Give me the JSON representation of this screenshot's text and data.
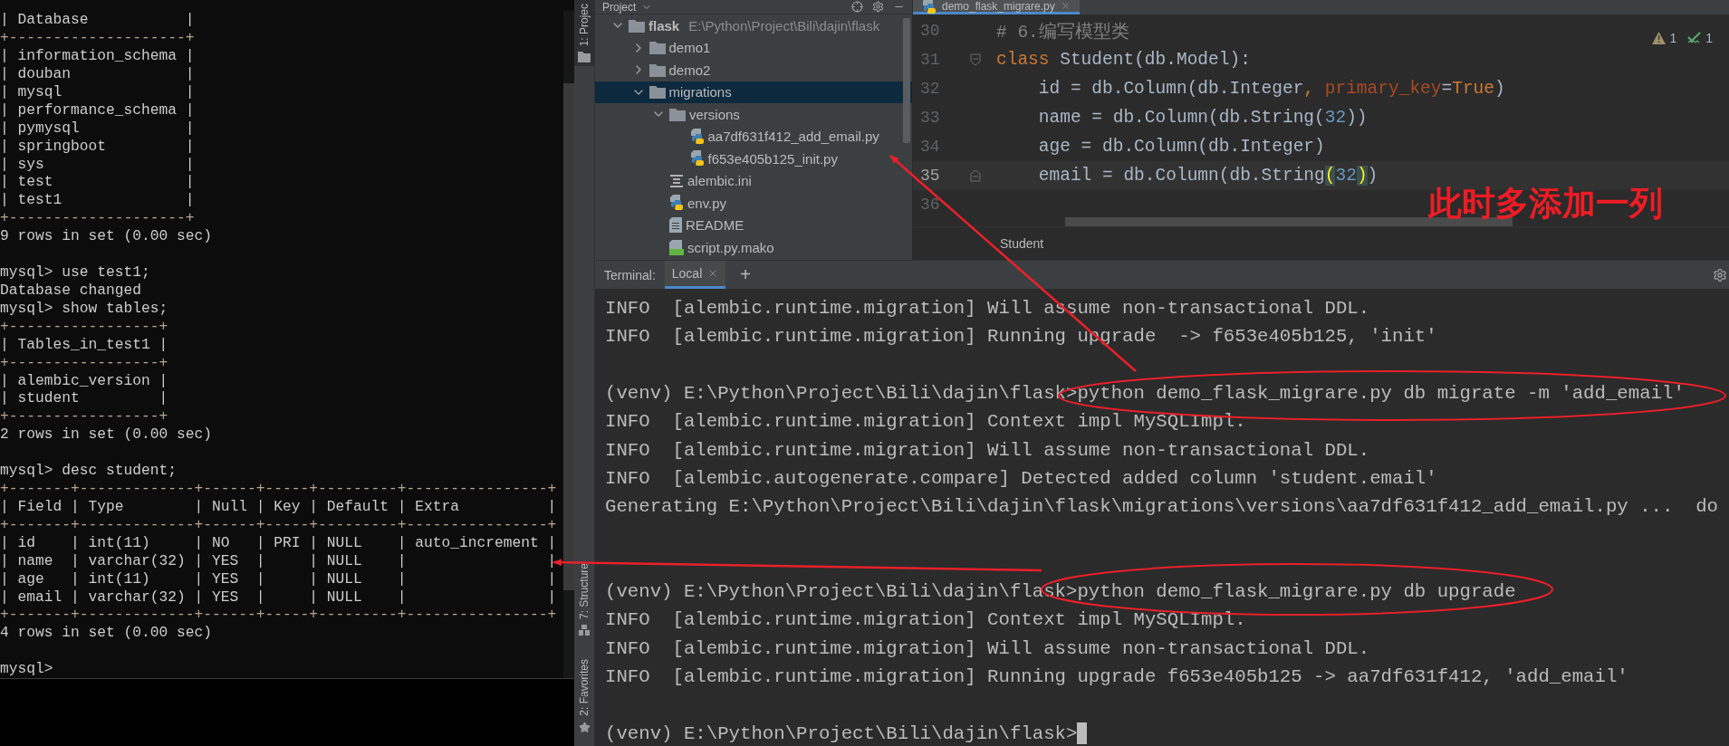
{
  "mysql_console": {
    "lines": [
      {
        "kind": "output",
        "text": "| Database           |"
      },
      {
        "kind": "border",
        "text": "+--------------------+"
      },
      {
        "kind": "output",
        "text": "| information_schema |"
      },
      {
        "kind": "output",
        "text": "| douban             |"
      },
      {
        "kind": "output",
        "text": "| mysql              |"
      },
      {
        "kind": "output",
        "text": "| performance_schema |"
      },
      {
        "kind": "output",
        "text": "| pymysql            |"
      },
      {
        "kind": "output",
        "text": "| springboot         |"
      },
      {
        "kind": "output",
        "text": "| sys                |"
      },
      {
        "kind": "output",
        "text": "| test               |"
      },
      {
        "kind": "output",
        "text": "| test1              |"
      },
      {
        "kind": "border",
        "text": "+--------------------+"
      },
      {
        "kind": "output",
        "text": "9 rows in set (0.00 sec)"
      },
      {
        "kind": "blank"
      },
      {
        "kind": "output",
        "text": "mysql> use test1;"
      },
      {
        "kind": "output",
        "text": "Database changed"
      },
      {
        "kind": "output",
        "text": "mysql> show tables;"
      },
      {
        "kind": "border",
        "text": "+-----------------+"
      },
      {
        "kind": "output",
        "text": "| Tables_in_test1 |"
      },
      {
        "kind": "border",
        "text": "+-----------------+"
      },
      {
        "kind": "output",
        "text": "| alembic_version |"
      },
      {
        "kind": "output",
        "text": "| student         |"
      },
      {
        "kind": "border",
        "text": "+-----------------+"
      },
      {
        "kind": "output",
        "text": "2 rows in set (0.00 sec)"
      },
      {
        "kind": "blank"
      },
      {
        "kind": "output",
        "text": "mysql> desc student;"
      },
      {
        "kind": "border",
        "text": "+-------+-------------+------+-----+---------+----------------+"
      },
      {
        "kind": "output",
        "text": "| Field | Type        | Null | Key | Default | Extra          |"
      },
      {
        "kind": "border",
        "text": "+-------+-------------+------+-----+---------+----------------+"
      },
      {
        "kind": "output",
        "text": "| id    | int(11)     | NO   | PRI | NULL    | auto_increment |"
      },
      {
        "kind": "output",
        "text": "| name  | varchar(32) | YES  |     | NULL    |                |"
      },
      {
        "kind": "output",
        "text": "| age   | int(11)     | YES  |     | NULL    |                |"
      },
      {
        "kind": "output",
        "text": "| email | varchar(32) | YES  |     | NULL    |                |"
      },
      {
        "kind": "border",
        "text": "+-------+-------------+------+-----+---------+----------------+"
      },
      {
        "kind": "output",
        "text": "4 rows in set (0.00 sec)"
      },
      {
        "kind": "blank"
      },
      {
        "kind": "output",
        "text": "mysql>"
      }
    ]
  },
  "ide": {
    "tool_strip": {
      "top": [
        {
          "label": "1: Projec",
          "selected": true
        }
      ],
      "bottom": [
        {
          "label": "7: Structure",
          "kind": "structure",
          "selected": false
        },
        {
          "label": "2: Favorites",
          "kind": "favorites",
          "selected": false
        }
      ]
    },
    "project_panel": {
      "title": "Project",
      "tree": [
        {
          "name": "flask",
          "path": "E:\\Python\\Project\\Bili\\dajin\\flask",
          "kind": "folder",
          "expanded": true,
          "selected": false,
          "children": [
            {
              "name": "demo1",
              "kind": "folder",
              "expanded": false,
              "selected": false
            },
            {
              "name": "demo2",
              "kind": "folder",
              "expanded": false,
              "selected": false
            },
            {
              "name": "migrations",
              "kind": "folder",
              "expanded": true,
              "selected": true,
              "children": [
                {
                  "name": "versions",
                  "kind": "folder",
                  "expanded": true,
                  "selected": false,
                  "children": [
                    {
                      "name": "aa7df631f412_add_email.py",
                      "kind": "python",
                      "selected": false
                    },
                    {
                      "name": "f653e405b125_init.py",
                      "kind": "python",
                      "selected": false
                    }
                  ]
                },
                {
                  "name": "alembic.ini",
                  "kind": "ini",
                  "selected": false
                },
                {
                  "name": "env.py",
                  "kind": "python",
                  "selected": false
                },
                {
                  "name": "README",
                  "kind": "text",
                  "selected": false
                },
                {
                  "name": "script.py.mako",
                  "kind": "mako",
                  "selected": false
                }
              ]
            }
          ]
        }
      ]
    },
    "editor": {
      "tab": "demo_flask_migrare.py",
      "inspections": [
        {
          "kind": "warning",
          "count": "1"
        },
        {
          "kind": "ok",
          "count": "1"
        }
      ],
      "lines": [
        {
          "number": "30",
          "current": false,
          "tokens": [
            {
              "kind": "comment",
              "text": "# 6.编写模型类"
            }
          ]
        },
        {
          "number": "31",
          "current": false,
          "fold_open": true,
          "tokens": [
            {
              "kind": "keyword",
              "text": "class"
            },
            {
              "kind": "text",
              "text": " Student(db.Model):"
            }
          ]
        },
        {
          "number": "32",
          "current": false,
          "tokens": [
            {
              "kind": "text",
              "text": "    id = db.Column(db.Integer"
            },
            {
              "kind": "keyword",
              "text": ", "
            },
            {
              "kind": "param",
              "text": "primary_key"
            },
            {
              "kind": "text",
              "text": "="
            },
            {
              "kind": "keyword",
              "text": "True"
            },
            {
              "kind": "text",
              "text": ")"
            }
          ]
        },
        {
          "number": "33",
          "current": false,
          "tokens": [
            {
              "kind": "text",
              "text": "    name = db.Column(db.String("
            },
            {
              "kind": "number",
              "text": "32"
            },
            {
              "kind": "text",
              "text": "))"
            }
          ]
        },
        {
          "number": "34",
          "current": false,
          "tokens": [
            {
              "kind": "text",
              "text": "    age = db.Column(db.Integer)"
            }
          ]
        },
        {
          "number": "35",
          "current": true,
          "fold_close": true,
          "tokens": [
            {
              "kind": "text",
              "text": "    email = db.Column(db.String"
            },
            {
              "kind": "match",
              "text": "("
            },
            {
              "kind": "number",
              "text": "32"
            },
            {
              "kind": "match",
              "text": ")"
            },
            {
              "kind": "text",
              "text": ")"
            }
          ]
        },
        {
          "number": "36",
          "current": false
        }
      ],
      "breadcrumb": "Student"
    },
    "annotation": "此时多添加一列",
    "terminal": {
      "label": "Terminal:",
      "tabs": [
        {
          "label": "Local",
          "selected": true
        }
      ],
      "add": "+",
      "lines": [
        {
          "kind": "output",
          "text": "INFO  [alembic.runtime.migration] Will assume non-transactional DDL."
        },
        {
          "kind": "output",
          "text": "INFO  [alembic.runtime.migration] Running upgrade  -> f653e405b125, 'init'"
        },
        {
          "kind": "blank"
        },
        {
          "kind": "output",
          "text": "(venv) E:\\Python\\Project\\Bili\\dajin\\flask>python demo_flask_migrare.py db migrate -m 'add_email'"
        },
        {
          "kind": "output",
          "text": "INFO  [alembic.runtime.migration] Context impl MySQLImpl."
        },
        {
          "kind": "output",
          "text": "INFO  [alembic.runtime.migration] Will assume non-transactional DDL."
        },
        {
          "kind": "output",
          "text": "INFO  [alembic.autogenerate.compare] Detected added column 'student.email'"
        },
        {
          "kind": "output",
          "text": "Generating E:\\Python\\Project\\Bili\\dajin\\flask\\migrations\\versions\\aa7df631f412_add_email.py ...  do"
        },
        {
          "kind": "blank"
        },
        {
          "kind": "blank"
        },
        {
          "kind": "output",
          "text": "(venv) E:\\Python\\Project\\Bili\\dajin\\flask>python demo_flask_migrare.py db upgrade"
        },
        {
          "kind": "output",
          "text": "INFO  [alembic.runtime.migration] Context impl MySQLImpl."
        },
        {
          "kind": "output",
          "text": "INFO  [alembic.runtime.migration] Will assume non-transactional DDL."
        },
        {
          "kind": "output",
          "text": "INFO  [alembic.runtime.migration] Running upgrade f653e405b125 -> aa7df631f412, 'add_email'"
        },
        {
          "kind": "blank"
        },
        {
          "kind": "prompt",
          "text": "(venv) E:\\Python\\Project\\Bili\\dajin\\flask>"
        }
      ]
    }
  }
}
